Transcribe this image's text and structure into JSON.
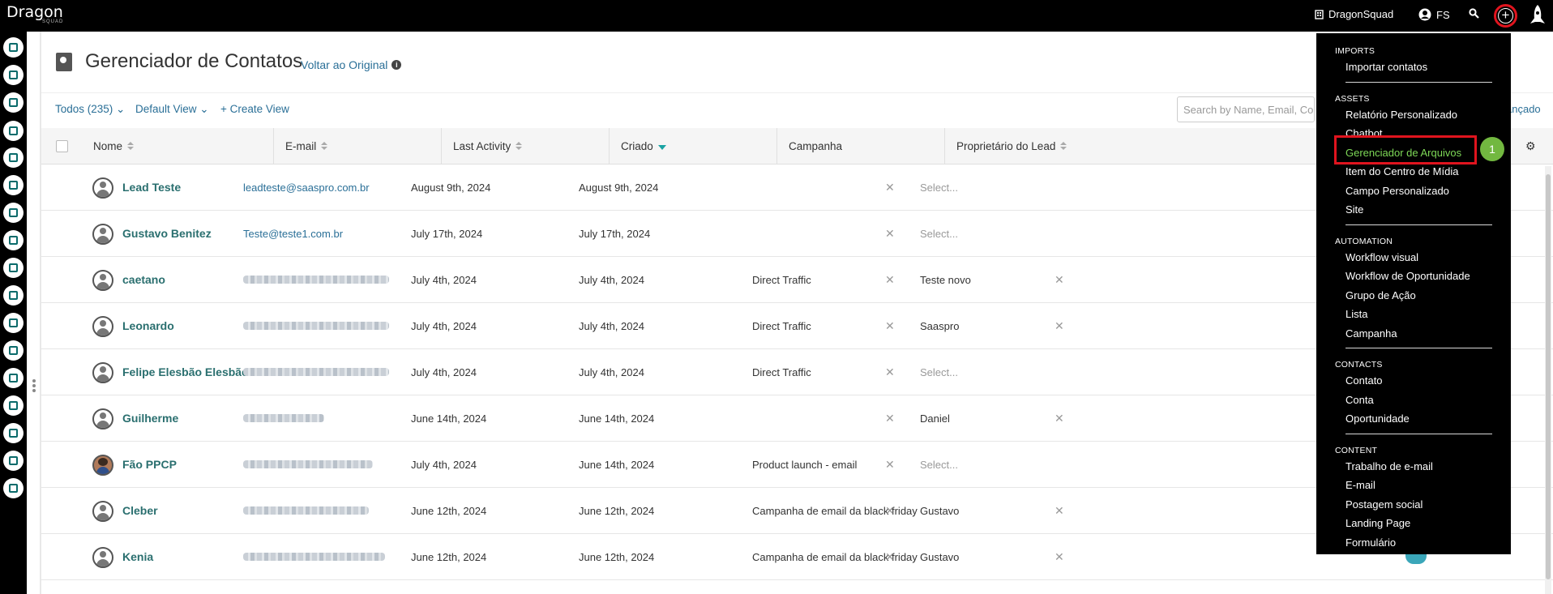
{
  "topbar": {
    "logo": "Dragon",
    "logo_sub": "SQUAD",
    "org": "DragonSquad",
    "user": "FS"
  },
  "header": {
    "title": "Gerenciador de Contatos",
    "back_link": "Voltar ao Original"
  },
  "views": {
    "all": "Todos (235)",
    "default_view": "Default View",
    "create": "+ Create View",
    "search_placeholder": "Search by Name, Email, Company",
    "advanced": "ançado"
  },
  "columns": {
    "name": "Nome",
    "email": "E-mail",
    "last_activity": "Last Activity",
    "created": "Criado",
    "campaign": "Campanha",
    "owner": "Proprietário do Lead"
  },
  "rows": [
    {
      "name": "Lead Teste",
      "email": "leadteste@saaspro.com.br",
      "last": "August 9th, 2024",
      "created": "August 9th, 2024",
      "campaign": "",
      "owner": "Select..."
    },
    {
      "name": "Gustavo Benitez",
      "email": "Teste@teste1.com.br",
      "last": "July 17th, 2024",
      "created": "July 17th, 2024",
      "campaign": "",
      "owner": "Select..."
    },
    {
      "name": "caetano",
      "email": "",
      "last": "July 4th, 2024",
      "created": "July 4th, 2024",
      "campaign": "Direct Traffic",
      "owner": "Teste novo"
    },
    {
      "name": "Leonardo",
      "email": "",
      "last": "July 4th, 2024",
      "created": "July 4th, 2024",
      "campaign": "Direct Traffic",
      "owner": "Saaspro"
    },
    {
      "name": "Felipe Elesbão Elesbão",
      "email": "",
      "last": "July 4th, 2024",
      "created": "July 4th, 2024",
      "campaign": "Direct Traffic",
      "owner": "Select..."
    },
    {
      "name": "Guilherme",
      "email": "",
      "last": "June 14th, 2024",
      "created": "June 14th, 2024",
      "campaign": "",
      "owner": "Daniel"
    },
    {
      "name": "Fão PPCP",
      "email": "",
      "last": "July 4th, 2024",
      "created": "June 14th, 2024",
      "campaign": "Product launch - email",
      "owner": "Select..."
    },
    {
      "name": "Cleber",
      "email": "",
      "last": "June 12th, 2024",
      "created": "June 12th, 2024",
      "campaign": "Campanha de email da black friday",
      "owner": "Gustavo"
    },
    {
      "name": "Kenia",
      "email": "",
      "last": "June 12th, 2024",
      "created": "June 12th, 2024",
      "campaign": "Campanha de email da black friday",
      "owner": "Gustavo"
    }
  ],
  "menu": {
    "imports": {
      "title": "IMPORTS",
      "items": [
        "Importar contatos"
      ]
    },
    "assets": {
      "title": "ASSETS",
      "items": [
        "Relatório Personalizado",
        "Chatbot",
        "Gerenciador de Arquivos",
        "Item do Centro de Mídia",
        "Campo Personalizado",
        "Site"
      ]
    },
    "automation": {
      "title": "AUTOMATION",
      "items": [
        "Workflow visual",
        "Workflow de Oportunidade",
        "Grupo de Ação",
        "Lista",
        "Campanha"
      ]
    },
    "contacts": {
      "title": "CONTACTS",
      "items": [
        "Contato",
        "Conta",
        "Oportunidade"
      ]
    },
    "content": {
      "title": "CONTENT",
      "items": [
        "Trabalho de e-mail",
        "E-mail",
        "Postagem social",
        "Landing Page",
        "Formulário"
      ]
    }
  },
  "annotation": {
    "step": "1"
  },
  "colors": {
    "accent": "#2a6f97",
    "highlight": "#7ed957",
    "callout": "#e0141e",
    "badge": "#72b840"
  }
}
